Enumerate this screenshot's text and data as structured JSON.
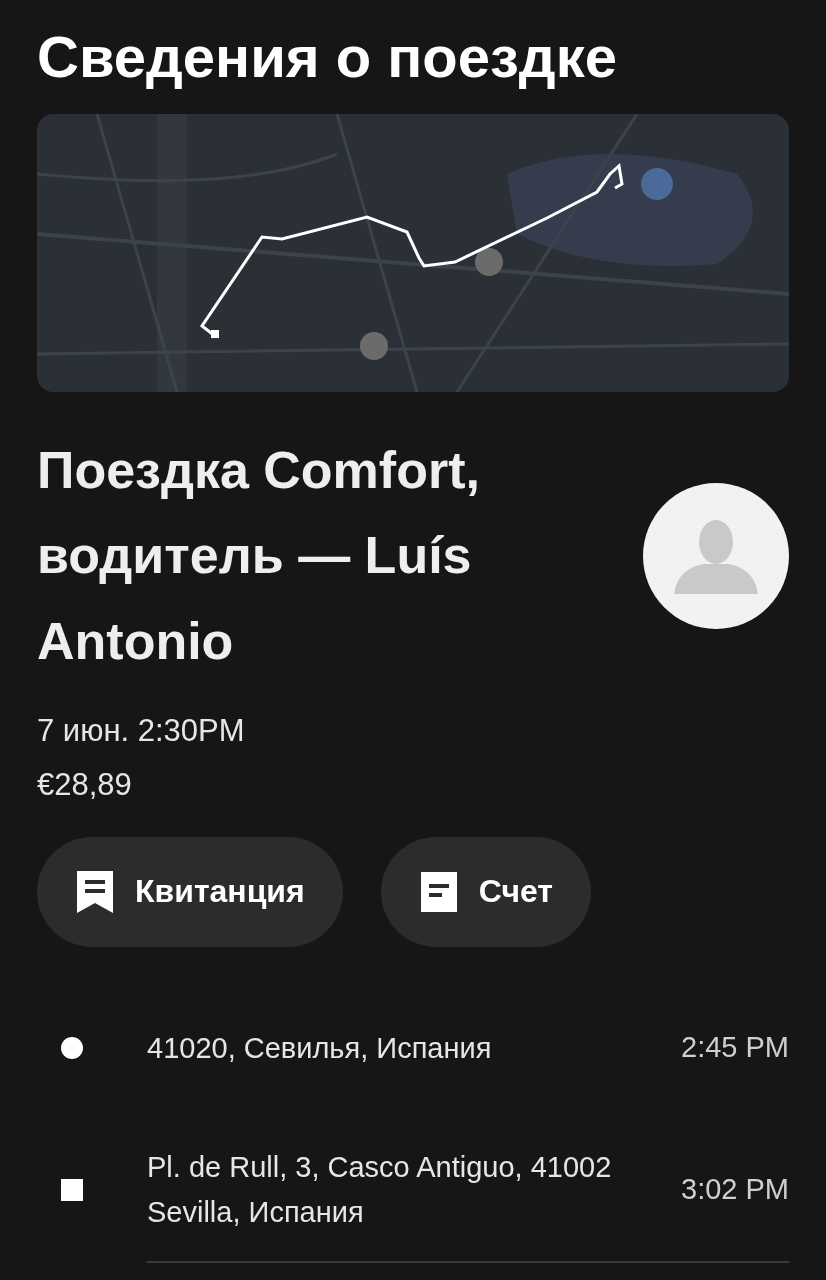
{
  "title": "Сведения о поездке",
  "trip": {
    "heading": "Поездка Comfort, водитель — Luís Antonio",
    "date": "7 июн. 2:30PM",
    "price": "€28,89"
  },
  "buttons": [
    {
      "kind": "receipt",
      "label": "Квитанция"
    },
    {
      "kind": "invoice",
      "label": "Счет"
    }
  ],
  "stops": [
    {
      "kind": "pickup",
      "address": "41020, Севилья, Испания",
      "time": "2:45 PM"
    },
    {
      "kind": "dropoff",
      "address": "Pl. de Rull, 3, Casco Antiguo, 41002 Sevilla, Испания",
      "time": "3:02 PM"
    }
  ]
}
